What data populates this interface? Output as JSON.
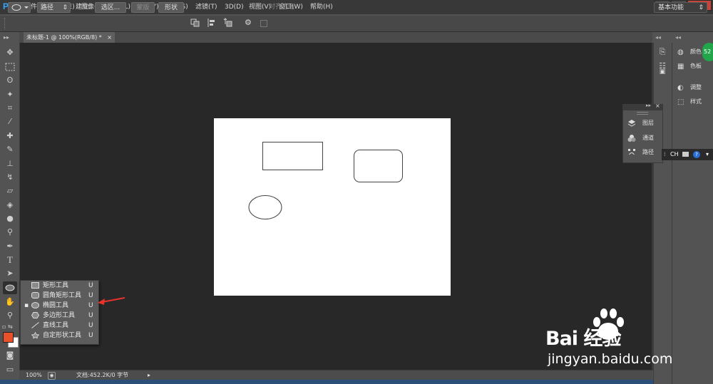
{
  "app": {
    "logo": "Ps",
    "menu": [
      "文件(F)",
      "编辑(E)",
      "图像(I)",
      "图层(L)",
      "文字(Y)",
      "选择(S)",
      "滤镜(T)",
      "3D(D)",
      "视图(V)",
      "窗口(W)",
      "帮助(H)"
    ],
    "window_buttons": [
      "–",
      "▫",
      "✕"
    ]
  },
  "options": {
    "mode_value": "路径",
    "build_label": "建立:",
    "selection_button": "选区...",
    "mask_button": "蒙版",
    "shape_button": "形状",
    "align_edges_label": "对齐边缘",
    "workspace": "基本功能"
  },
  "document": {
    "tab_title": "未标题-1 @ 100%(RGB/8) *",
    "zoom": "100%",
    "doc_info": "文档:452.2K/0 字节"
  },
  "tool_flyout": {
    "items": [
      {
        "label": "矩形工具",
        "key": "U",
        "icon": "rect-icon",
        "active": false
      },
      {
        "label": "圆角矩形工具",
        "key": "U",
        "icon": "rounded-rect-icon",
        "active": false
      },
      {
        "label": "椭圆工具",
        "key": "U",
        "icon": "ellipse-icon",
        "active": true
      },
      {
        "label": "多边形工具",
        "key": "U",
        "icon": "polygon-icon",
        "active": false
      },
      {
        "label": "直线工具",
        "key": "U",
        "icon": "line-icon",
        "active": false
      },
      {
        "label": "自定形状工具",
        "key": "U",
        "icon": "custom-shape-icon",
        "active": false
      }
    ],
    "active_bullet": "▪"
  },
  "right_panels": {
    "dock": [
      {
        "label": "颜色",
        "icon": "color-icon"
      },
      {
        "label": "色板",
        "icon": "swatches-icon"
      },
      {
        "label": "调整",
        "icon": "adjustments-icon"
      },
      {
        "label": "样式",
        "icon": "styles-icon"
      }
    ],
    "floating": [
      {
        "label": "图层",
        "icon": "layers-icon"
      },
      {
        "label": "通道",
        "icon": "channels-icon"
      },
      {
        "label": "路径",
        "icon": "paths-icon"
      }
    ],
    "badge": "52",
    "ch_label": "CH"
  },
  "colors": {
    "foreground": "#e8522a",
    "background": "#ffffff",
    "annotation_arrow": "#e8322a"
  },
  "watermark": {
    "brand": "Bai 经验",
    "url": "jingyan.baidu.com"
  }
}
